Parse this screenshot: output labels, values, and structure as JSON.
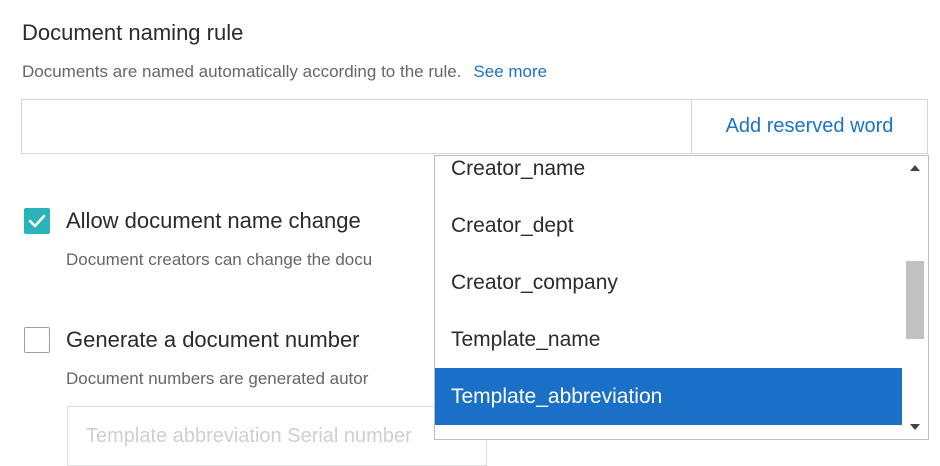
{
  "naming_rule": {
    "title": "Document naming rule",
    "description": "Documents are named automatically according to the rule.",
    "see_more": "See more",
    "input_value": "",
    "add_reserved_word": "Add reserved word"
  },
  "allow_name_change": {
    "checked": true,
    "label": "Allow document name change",
    "description": "Document creators can change the docu"
  },
  "generate_number": {
    "checked": false,
    "label": "Generate a document number",
    "description": "Document numbers are generated autor",
    "serial_placeholder": "Template abbreviation Serial number"
  },
  "reserved_word_dropdown": {
    "items": [
      {
        "label": "Creator_name",
        "selected": false
      },
      {
        "label": "Creator_dept",
        "selected": false
      },
      {
        "label": "Creator_company",
        "selected": false
      },
      {
        "label": "Template_name",
        "selected": false
      },
      {
        "label": "Template_abbreviation",
        "selected": true
      }
    ],
    "selected_color": "#1a6fc7"
  },
  "colors": {
    "link": "#1a73c6",
    "checkbox_checked": "#2bb3ba"
  }
}
